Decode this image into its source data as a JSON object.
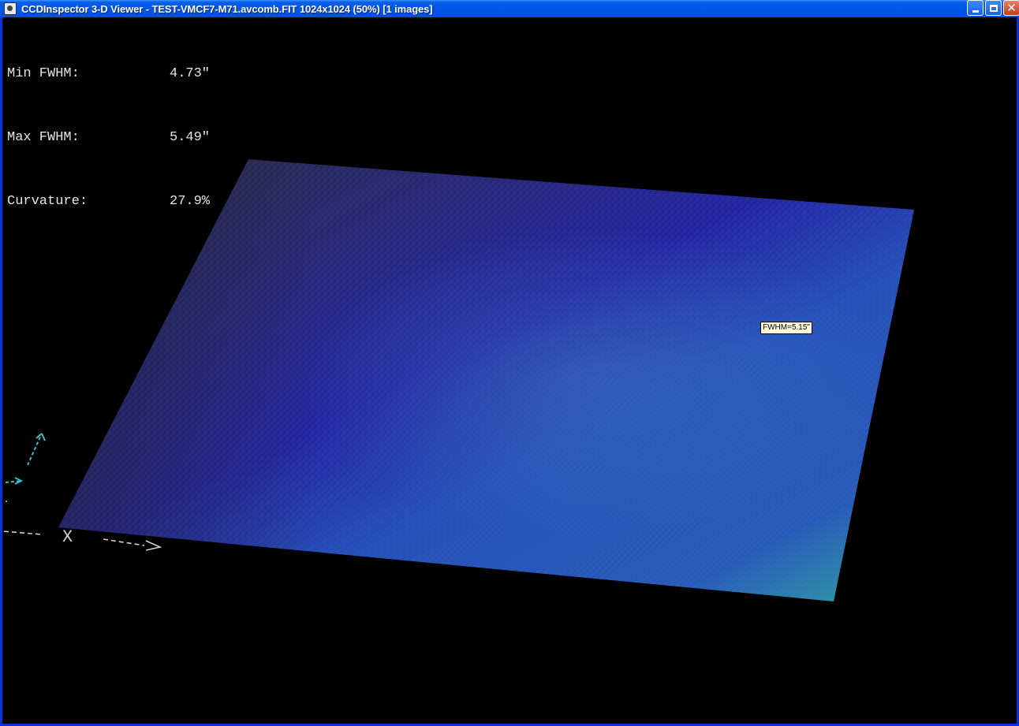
{
  "window": {
    "title": "CCDInspector 3-D Viewer - TEST-VMCF7-M71.avcomb.FIT 1024x1024 (50%)  [1 images]",
    "controls": {
      "minimize": "minimize",
      "maximize": "maximize",
      "close": "✕"
    }
  },
  "stats": {
    "min_fwhm_label": "Min FWHM:",
    "min_fwhm_value": "4.73″",
    "max_fwhm_label": "Max FWHM:",
    "max_fwhm_value": "5.49″",
    "curvature_label": "Curvature:",
    "curvature_value": "27.9%"
  },
  "tooltip": {
    "text": "FWHM=5.15\""
  },
  "axes": {
    "x_label": "X"
  },
  "colors": {
    "surface_dark": "#2b2b3e",
    "surface_blue": "#2222a6",
    "surface_teal": "#2fa1a1",
    "axis_cyan": "#30c0c8",
    "titlebar": "#0054e3"
  }
}
